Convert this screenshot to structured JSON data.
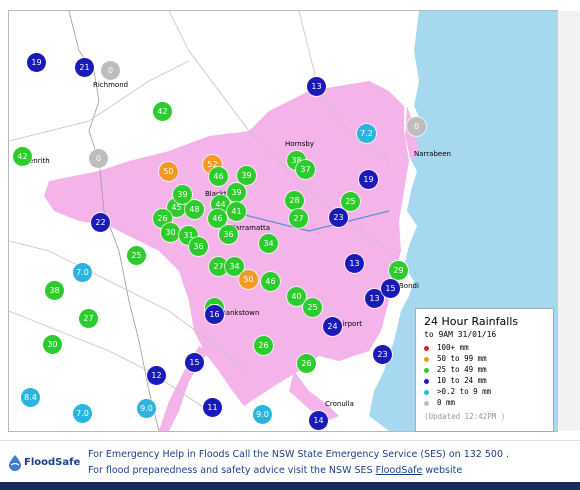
{
  "towns": {
    "richmond": "Richmond",
    "penrith": "Penrith",
    "hornsby": "Hornsby",
    "narrabeen": "Narrabeen",
    "parramatta": "Parramatta",
    "bondi": "Bondi",
    "bankstown": "Bankstown",
    "airport": "Airport",
    "cronulla": "Cronulla",
    "blacktown": "Blacktown"
  },
  "stations": [
    "19",
    "21",
    "0",
    "13",
    "42",
    "42",
    "0",
    "7.2",
    "0",
    "50",
    "52",
    "46",
    "39",
    "38",
    "37",
    "39",
    "44",
    "45",
    "48",
    "39",
    "41",
    "28",
    "25",
    "19",
    "26",
    "46",
    "30",
    "31",
    "36",
    "36",
    "27",
    "23",
    "22",
    "34",
    "25",
    "27",
    "34",
    "13",
    "50",
    "46",
    "29",
    "7.0",
    "40",
    "25",
    "13",
    "25",
    "24",
    "38",
    "27",
    "30",
    "26",
    "15",
    "26",
    "23",
    "12",
    "8.4",
    "7.0",
    "9.0",
    "11",
    "9.0",
    "14",
    "15",
    "16"
  ],
  "legend": {
    "title": "24 Hour Rainfalls",
    "date": "to 9AM 31/01/16",
    "rows": [
      {
        "label": "100+ mm",
        "color": "#e0201a"
      },
      {
        "label": "50  to 99 mm",
        "color": "#f39a20"
      },
      {
        "label": "25  to 49 mm",
        "color": "#2bcc2b"
      },
      {
        "label": "10  to 24 mm",
        "color": "#1a1ab8"
      },
      {
        "label": ">0.2 to 9 mm",
        "color": "#2ab4e0"
      },
      {
        "label": "0 mm",
        "color": "#bdbdbd"
      }
    ],
    "updated": "(Updated 12:42PM  )"
  },
  "footer": {
    "logo": "FloodSafe",
    "line1": "For Emergency Help in Floods Call the NSW State Emergency Service (SES) on 132 500 .",
    "line2_pre": "For flood preparedness and safety advice visit the NSW SES ",
    "line2_link": "FloodSafe",
    "line2_post": " website"
  },
  "colors": {
    "sea": "#a6d8f0",
    "urban": "#f4b4ea",
    "land": "#ffffff"
  }
}
